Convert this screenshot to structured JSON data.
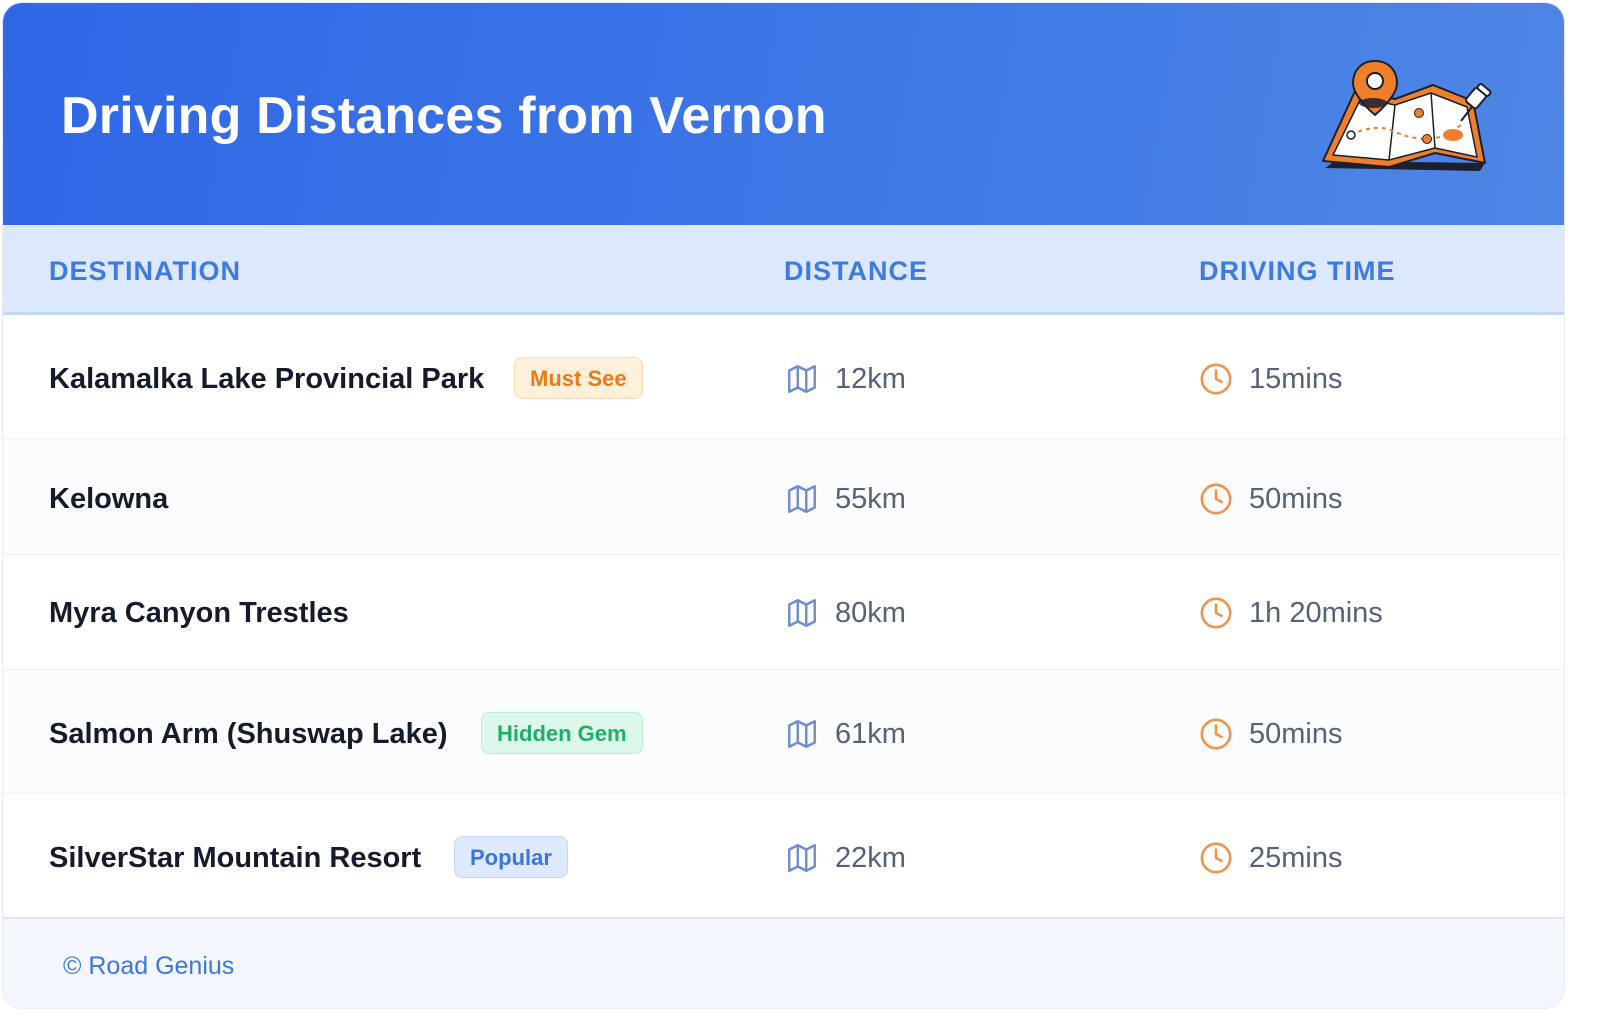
{
  "header": {
    "title": "Driving Distances from Vernon",
    "illustration": "map-with-location-pin-icon"
  },
  "table": {
    "columns": [
      "DESTINATION",
      "DISTANCE",
      "DRIVING TIME"
    ],
    "distance_icon": "map-icon",
    "time_icon": "clock-icon",
    "rows": [
      {
        "destination": "Kalamalka Lake Provincial Park",
        "badge": "Must See",
        "distance": "12km",
        "time": "15mins"
      },
      {
        "destination": "Kelowna",
        "badge": "",
        "distance": "55km",
        "time": "50mins"
      },
      {
        "destination": "Myra Canyon Trestles",
        "badge": "",
        "distance": "80km",
        "time": "1h 20mins"
      },
      {
        "destination": "Salmon Arm (Shuswap Lake)",
        "badge": "Hidden Gem",
        "distance": "61km",
        "time": "50mins"
      },
      {
        "destination": "SilverStar Mountain Resort",
        "badge": "Popular",
        "distance": "22km",
        "time": "25mins"
      }
    ]
  },
  "footer": {
    "text": "© Road Genius"
  },
  "colors": {
    "header_blue": "#2f67e6",
    "header_text": "#ffffff",
    "column_header": "#3f7ae0",
    "map_icon": "#6d8bd6",
    "clock_icon": "#f0924a",
    "badge_must_see": "#ec7a17",
    "badge_hidden_gem": "#1fb068",
    "badge_popular": "#3b76df"
  }
}
